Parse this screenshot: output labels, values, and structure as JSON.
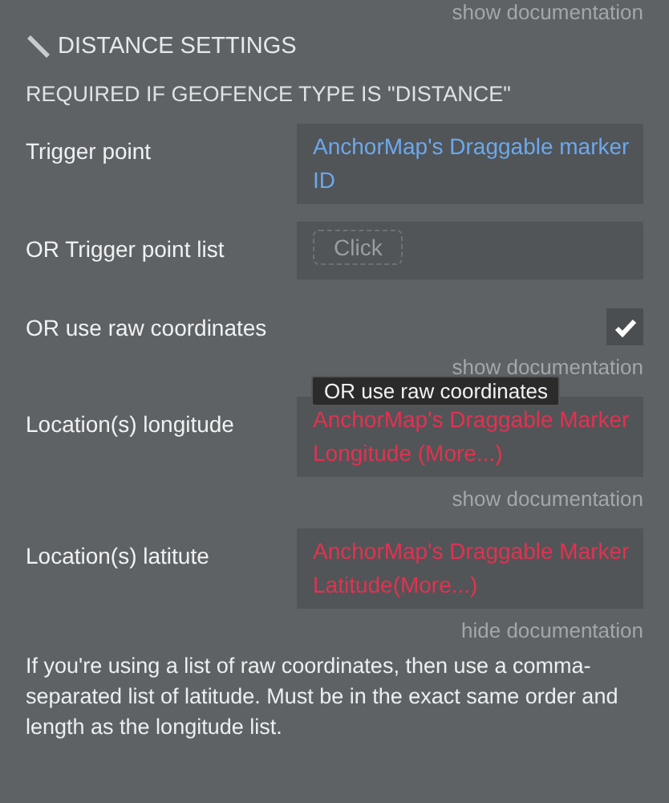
{
  "top_doc_link": "show documentation",
  "section": {
    "title": "DISTANCE SETTINGS",
    "subtitle": "REQUIRED IF GEOFENCE TYPE IS \"DISTANCE\""
  },
  "fields": [
    {
      "kind": "dynamic",
      "label": "Trigger point",
      "value": "AnchorMap's Draggable marker ID",
      "invalid": false
    },
    {
      "kind": "list",
      "label": "OR Trigger point list",
      "button": "Click"
    },
    {
      "kind": "checkbox",
      "label": "OR use raw coordinates",
      "checked": true,
      "doc_link": "show documentation"
    },
    {
      "kind": "dynamic",
      "label": "Location(s) longitude",
      "value": "AnchorMap's Draggable Marker Longitude (More...)",
      "invalid": true,
      "doc_link": "show documentation"
    },
    {
      "kind": "dynamic",
      "label": "Location(s) latitute",
      "value": "AnchorMap's Draggable Marker Latitude(More...)",
      "invalid": true,
      "doc_link": "hide documentation",
      "documentation": "If you're using a list of raw coordinates, then use a comma-separated list of latitude. Must be in the exact same order and length as the longitude list."
    }
  ],
  "tooltip": {
    "text": "OR use raw coordinates"
  }
}
